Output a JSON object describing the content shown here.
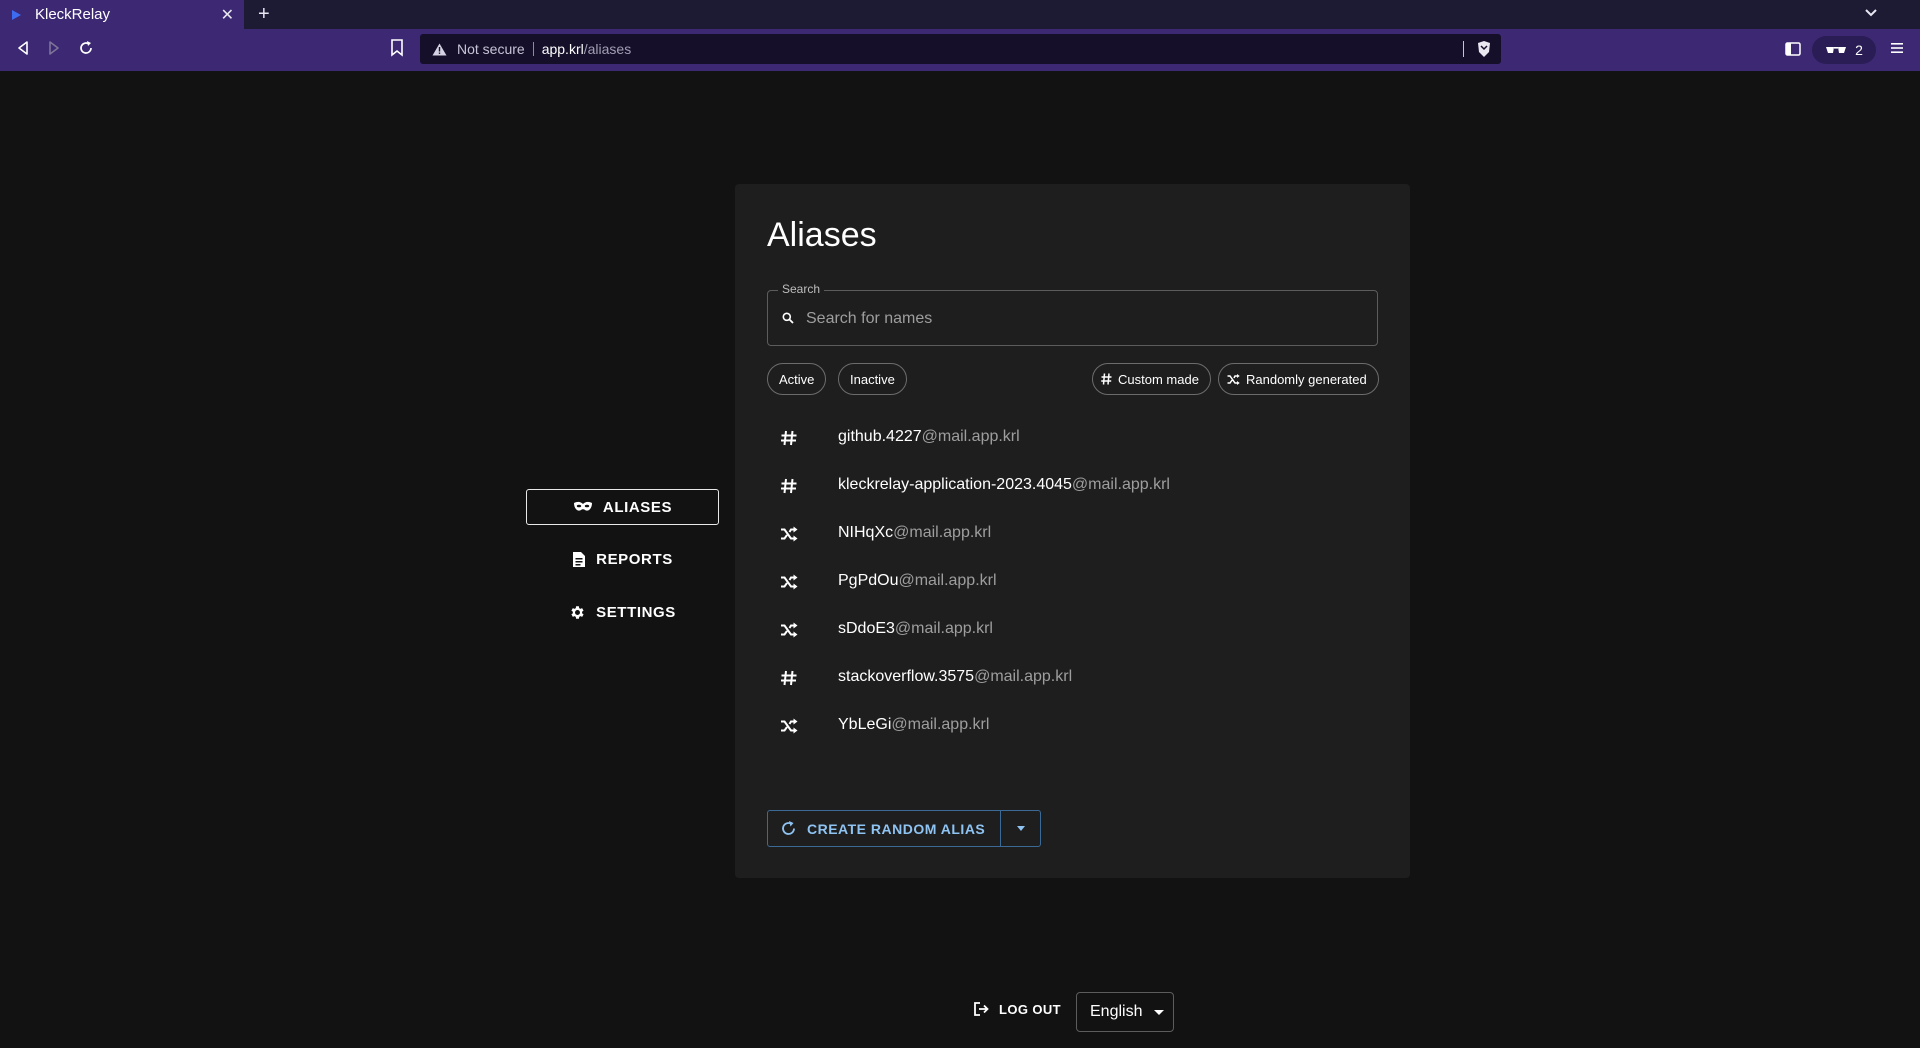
{
  "browser": {
    "tab_title": "KleckRelay",
    "url_not_secure": "Not secure",
    "url_host": "app.krl",
    "url_path": "/aliases",
    "rewards_count": "2",
    "accent_color": "#3c2873"
  },
  "nav": {
    "items": [
      {
        "label": "ALIASES",
        "icon": "mask-icon",
        "active": true
      },
      {
        "label": "REPORTS",
        "icon": "document-icon",
        "active": false
      },
      {
        "label": "SETTINGS",
        "icon": "gear-icon",
        "active": false
      }
    ]
  },
  "main": {
    "title": "Aliases",
    "search": {
      "label": "Search",
      "placeholder": "Search for names",
      "value": ""
    },
    "filters": {
      "active": "Active",
      "inactive": "Inactive",
      "custom": "Custom made",
      "random": "Randomly generated"
    },
    "aliases": [
      {
        "type": "custom",
        "icon": "hash-icon",
        "local": "github.4227",
        "domain": "@mail.app.krl"
      },
      {
        "type": "custom",
        "icon": "hash-icon",
        "local": "kleckrelay-application-2023.4045",
        "domain": "@mail.app.krl"
      },
      {
        "type": "random",
        "icon": "shuffle-icon",
        "local": "NIHqXc",
        "domain": "@mail.app.krl"
      },
      {
        "type": "random",
        "icon": "shuffle-icon",
        "local": "PgPdOu",
        "domain": "@mail.app.krl"
      },
      {
        "type": "random",
        "icon": "shuffle-icon",
        "local": "sDdoE3",
        "domain": "@mail.app.krl"
      },
      {
        "type": "custom",
        "icon": "hash-icon",
        "local": "stackoverflow.3575",
        "domain": "@mail.app.krl"
      },
      {
        "type": "random",
        "icon": "shuffle-icon",
        "local": "YbLeGi",
        "domain": "@mail.app.krl"
      }
    ],
    "create_button": "CREATE RANDOM ALIAS",
    "create_color": "#8ec3f2"
  },
  "footer": {
    "logout": "LOG OUT",
    "language": "English"
  }
}
